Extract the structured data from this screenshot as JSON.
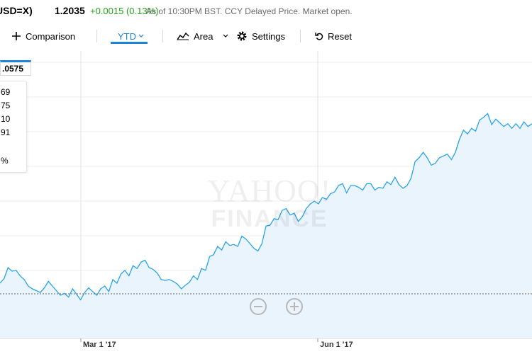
{
  "quote": {
    "symbol_fragment": "USD=X)",
    "price": "1.2035",
    "change": "+0.0015 (0.13%)",
    "as_of": "As of 10:30PM BST. CCY Delayed Price. Market open."
  },
  "toolbar": {
    "comparison_label": "Comparison",
    "range_label": "YTD",
    "chart_type_label": "Area",
    "settings_label": "Settings",
    "reset_label": "Reset"
  },
  "crosshair": {
    "price_tag": ".0575"
  },
  "tooltip_panel": {
    "lines": [
      "69",
      "75",
      "10",
      "91",
      "",
      "%"
    ]
  },
  "watermark": {
    "line1": "YAHOO!",
    "line2": "FINANCE"
  },
  "colors": {
    "line": "#29a3e9",
    "area": "#eaf4fc",
    "accent": "#1d84d9",
    "positive": "#21a31a"
  },
  "chart_data": {
    "type": "area",
    "x_tick_labels": [
      "Mar 1 '17",
      "Jun 1 '17"
    ],
    "title": "",
    "xlabel": "",
    "ylabel": "",
    "grid": true,
    "values": [
      1.058,
      1.063,
      1.075,
      1.071,
      1.072,
      1.066,
      1.062,
      1.055,
      1.052,
      1.05,
      1.048,
      1.053,
      1.06,
      1.055,
      1.05,
      1.045,
      1.047,
      1.043,
      1.052,
      1.046,
      1.04,
      1.048,
      1.053,
      1.049,
      1.045,
      1.052,
      1.055,
      1.049,
      1.062,
      1.058,
      1.068,
      1.072,
      1.066,
      1.077,
      1.074,
      1.081,
      1.083,
      1.075,
      1.073,
      1.069,
      1.062,
      1.061,
      1.062,
      1.06,
      1.057,
      1.052,
      1.056,
      1.059,
      1.066,
      1.062,
      1.074,
      1.072,
      1.087,
      1.089,
      1.098,
      1.094,
      1.103,
      1.099,
      1.1,
      1.098,
      1.109,
      1.106,
      1.101,
      1.096,
      1.093,
      1.101,
      1.12,
      1.121,
      1.128,
      1.127,
      1.137,
      1.139,
      1.132,
      1.134,
      1.125,
      1.13,
      1.139,
      1.144,
      1.147,
      1.144,
      1.151,
      1.149,
      1.155,
      1.157,
      1.164,
      1.166,
      1.156,
      1.164,
      1.164,
      1.162,
      1.159,
      1.166,
      1.166,
      1.159,
      1.162,
      1.161,
      1.168,
      1.165,
      1.173,
      1.165,
      1.161,
      1.164,
      1.172,
      1.19,
      1.194,
      1.2,
      1.194,
      1.186,
      1.188,
      1.194,
      1.196,
      1.198,
      1.192,
      1.2,
      1.214,
      1.224,
      1.22,
      1.226,
      1.223,
      1.235,
      1.238,
      1.242,
      1.23,
      1.236,
      1.232,
      1.228,
      1.231,
      1.226,
      1.231,
      1.226,
      1.233,
      1.228,
      1.231
    ]
  }
}
